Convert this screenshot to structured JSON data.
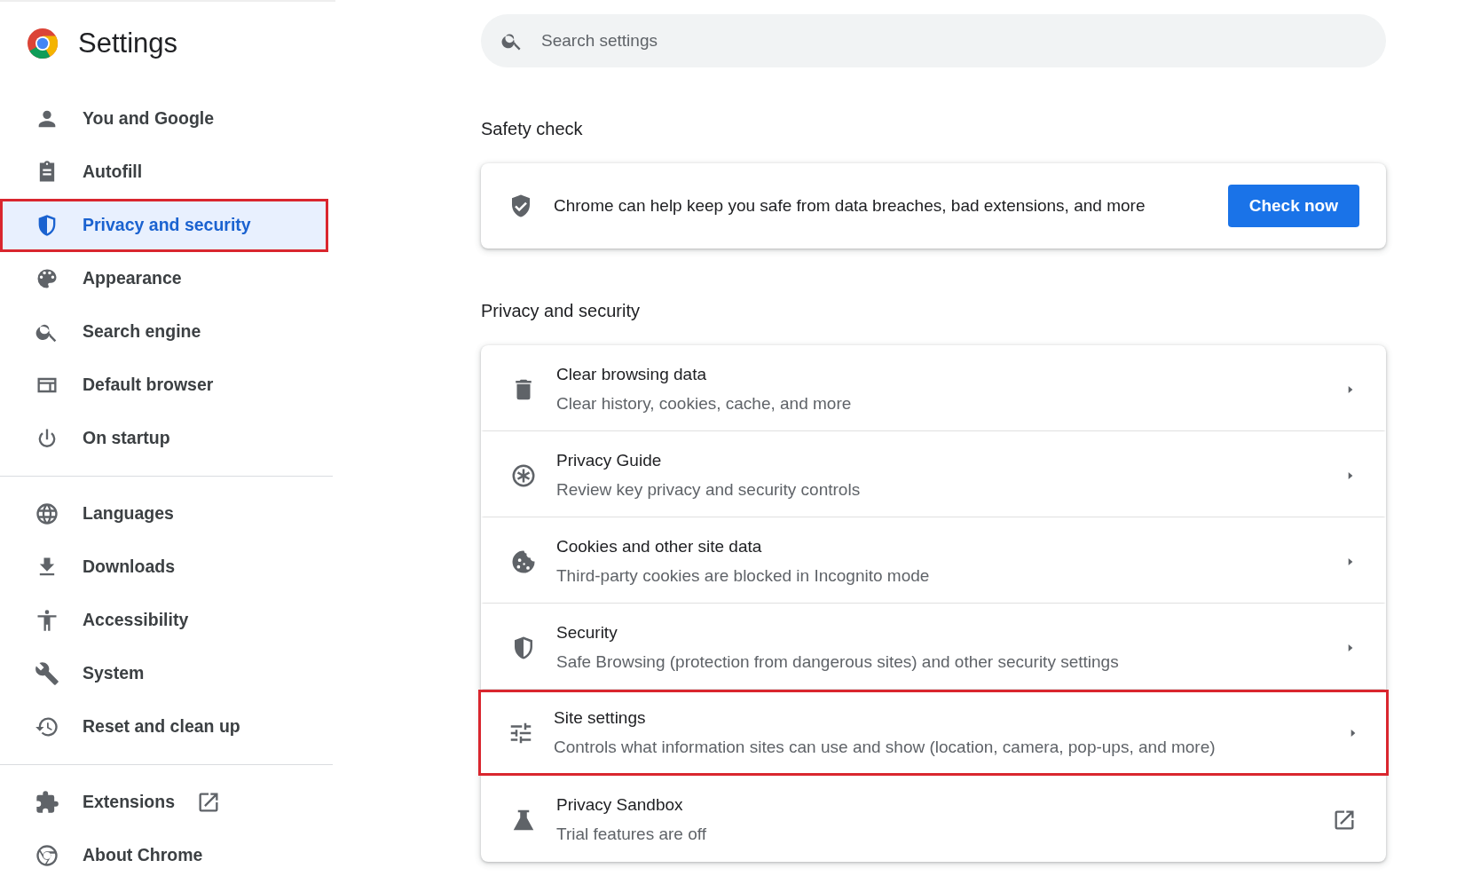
{
  "header": {
    "title": "Settings"
  },
  "search": {
    "placeholder": "Search settings"
  },
  "sidebar": {
    "groups": [
      {
        "items": [
          {
            "label": "You and Google",
            "selected": false,
            "highlighted": false
          },
          {
            "label": "Autofill",
            "selected": false,
            "highlighted": false
          },
          {
            "label": "Privacy and security",
            "selected": true,
            "highlighted": true
          },
          {
            "label": "Appearance",
            "selected": false,
            "highlighted": false
          },
          {
            "label": "Search engine",
            "selected": false,
            "highlighted": false
          },
          {
            "label": "Default browser",
            "selected": false,
            "highlighted": false
          },
          {
            "label": "On startup",
            "selected": false,
            "highlighted": false
          }
        ]
      },
      {
        "items": [
          {
            "label": "Languages",
            "selected": false,
            "highlighted": false
          },
          {
            "label": "Downloads",
            "selected": false,
            "highlighted": false
          },
          {
            "label": "Accessibility",
            "selected": false,
            "highlighted": false
          },
          {
            "label": "System",
            "selected": false,
            "highlighted": false
          },
          {
            "label": "Reset and clean up",
            "selected": false,
            "highlighted": false
          }
        ]
      },
      {
        "items": [
          {
            "label": "Extensions",
            "selected": false,
            "highlighted": false
          },
          {
            "label": "About Chrome",
            "selected": false,
            "highlighted": false
          }
        ]
      }
    ]
  },
  "safety_check": {
    "heading": "Safety check",
    "text": "Chrome can help keep you safe from data breaches, bad extensions, and more",
    "button": "Check now"
  },
  "privacy": {
    "heading": "Privacy and security",
    "rows": [
      {
        "title": "Clear browsing data",
        "subtitle": "Clear history, cookies, cache, and more",
        "highlighted": false
      },
      {
        "title": "Privacy Guide",
        "subtitle": "Review key privacy and security controls",
        "highlighted": false
      },
      {
        "title": "Cookies and other site data",
        "subtitle": "Third-party cookies are blocked in Incognito mode",
        "highlighted": false
      },
      {
        "title": "Security",
        "subtitle": "Safe Browsing (protection from dangerous sites) and other security settings",
        "highlighted": false
      },
      {
        "title": "Site settings",
        "subtitle": "Controls what information sites can use and show (location, camera, pop-ups, and more)",
        "highlighted": true
      },
      {
        "title": "Privacy Sandbox",
        "subtitle": "Trial features are off",
        "highlighted": false
      }
    ]
  }
}
